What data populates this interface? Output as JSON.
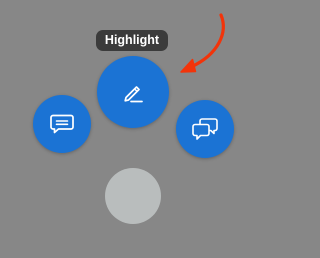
{
  "tooltip": {
    "label": "Highlight"
  },
  "menu": {
    "buttons": [
      {
        "id": "highlight",
        "icon": "pencil-icon"
      },
      {
        "id": "comment",
        "icon": "comment-bubble-icon"
      },
      {
        "id": "discussion",
        "icon": "discussion-bubbles-icon"
      },
      {
        "id": "close",
        "icon": "none"
      }
    ]
  },
  "annotation": {
    "icon": "curved-arrow-icon",
    "color": "#f2340a"
  },
  "colors": {
    "background": "#878787",
    "button": "#1b73d4",
    "close_button": "#b9bdbd",
    "tooltip_bg": "#3b3b3b"
  }
}
